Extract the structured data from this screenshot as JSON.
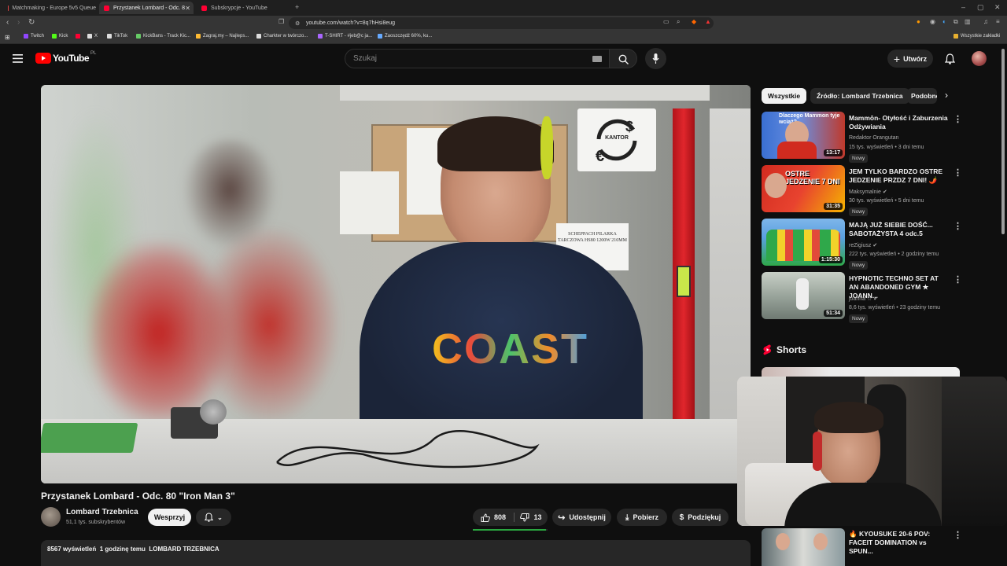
{
  "browser": {
    "tabs": [
      {
        "title": "Matchmaking - Europe 5v5 Queue",
        "color": "#d44"
      },
      {
        "title": "Przystanek Lombard - Odc. 8",
        "color": "#f03"
      },
      {
        "title": "Subskrypcje - YouTube",
        "color": "#f03"
      }
    ],
    "url": "youtube.com/watch?v=8q7hHsi8eug",
    "bookmarks": [
      {
        "label": "Twitch",
        "color": "#9146ff"
      },
      {
        "label": "Kick",
        "color": "#53fc18"
      },
      {
        "label": "",
        "color": "#f03"
      },
      {
        "label": "X",
        "color": "#ddd"
      },
      {
        "label": "TikTok",
        "color": "#ddd"
      },
      {
        "label": "KickBans - Track Kic...",
        "color": "#6c6"
      },
      {
        "label": "Zagraj.my – Najleps...",
        "color": "#fb3"
      },
      {
        "label": "Charkter w twórczo...",
        "color": "#ddd"
      },
      {
        "label": "T-SHIRT - #jeb@c ja...",
        "color": "#a6f"
      },
      {
        "label": "Zaoszczędź 60%, ku...",
        "color": "#6af"
      }
    ],
    "all_bookmarks_label": "Wszystkie zakładki"
  },
  "header": {
    "logo_text": "YouTube",
    "region": "PL",
    "search_placeholder": "Szukaj",
    "create_label": "Utwórz"
  },
  "video": {
    "title": "Przystanek Lombard - Odc. 80 \"Iron Man 3\"",
    "sign_text": "KANTOR",
    "note_text": "SCHEPPACH PILARKA TARCZOWA HS80 1200W 210MM",
    "shirt_text": "COAST"
  },
  "channel": {
    "name": "Lombard Trzebnica",
    "subscribers": "51,1 tys. subskrybentów",
    "support_label": "Wesprzyj"
  },
  "actions": {
    "likes": "808",
    "dislikes": "13",
    "share": "Udostępnij",
    "download": "Pobierz",
    "thanks": "Podziękuj"
  },
  "description_peek": "8567 wyświetleń  1 godzinę temu  LOMBARD TRZEBNICA",
  "chips": [
    "Wszystkie",
    "Źródło: Lombard Trzebnica",
    "Podobne"
  ],
  "recommendations": [
    {
      "title": "Mammōn- Otyłość i Zaburzenia Odżywiania",
      "channel": "Redaktor Orangutan",
      "meta": "15 tys. wyświetleń • 3 dni temu",
      "duration": "13:17",
      "badge": "Nowy",
      "thumb_text": "Dlaczego Mammon tyje wciąż?",
      "colors": [
        "#3a6fd1",
        "#c0392b"
      ]
    },
    {
      "title": "JEM TYLKO BARDZO OSTRE JEDZENIE PRZDZ 7 DNI! 🌶️",
      "channel": "Maksymalnie",
      "meta": "30 tys. wyświetleń • 5 dni temu",
      "duration": "31:35",
      "badge": "Nowy",
      "thumb_text": "OSTRE JEDZENIE 7 DNI",
      "colors": [
        "#d12b1f",
        "#f5b400"
      ]
    },
    {
      "title": "MAJĄ JUŻ SIEBIE DOŚĆ... SABOTAŻYSTA 4 odc.5",
      "channel": "reZigiusz",
      "meta": "222 tys. wyświetleń • 2 godziny temu",
      "duration": "1:15:30",
      "badge": "Nowy",
      "thumb_text": "",
      "colors": [
        "#5aa0e0",
        "#2fa84a"
      ]
    },
    {
      "title": "HYPNOTIC TECHNO SET AT AN ABANDONED GYM ★ JOANN...",
      "channel": "joanna ☆",
      "meta": "8,6 tys. wyświetleń • 23 godziny temu",
      "duration": "51:34",
      "badge": "Nowy",
      "thumb_text": "",
      "colors": [
        "#7d8a80",
        "#c8cfc6"
      ]
    }
  ],
  "shorts": {
    "heading": "Shorts",
    "bottom_title": "🔥 KYOUSUKE 20-6 POV: FACEIT DOMINATION vs SPUN..."
  }
}
